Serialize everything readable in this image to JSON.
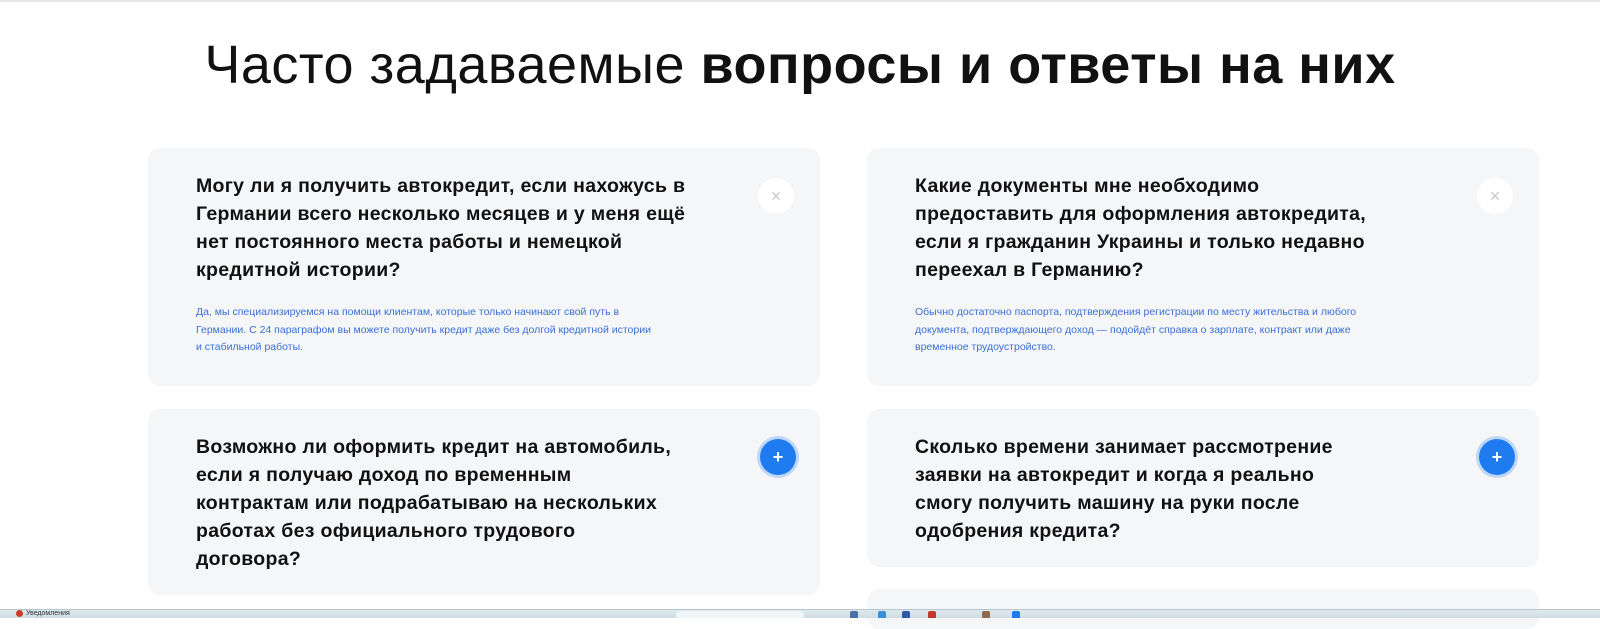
{
  "page": {
    "title_light": "Часто задаваемые",
    "title_bold": "вопросы и ответы на них"
  },
  "faq": {
    "items": [
      {
        "question": "Могу ли я получить автокредит, если нахожусь в Германии всего несколько месяцев и у меня ещё нет постоянного места работы и немецкой кредитной истории?",
        "answer": "Да, мы специализируемся на помощи клиентам, которые только начинают свой путь в Германии. С 24 параграфом вы можете получить кредит даже без долгой кредитной истории и стабильной работы.",
        "expanded": true,
        "toggle_icon": "close-icon",
        "toggle_symbol": "×"
      },
      {
        "question": "Какие документы мне необходимо предоставить для оформления автокредита, если я гражданин Украины и только недавно переехал в Германию?",
        "answer": "Обычно достаточно паспорта, подтверждения регистрации по месту жительства и любого документа, подтверждающего доход — подойдёт справка о зарплате, контракт или даже временное трудоустройство.",
        "expanded": true,
        "toggle_icon": "close-icon",
        "toggle_symbol": "×"
      },
      {
        "question": "Возможно ли оформить кредит на автомобиль, если я получаю доход по временным контрактам или подрабатываю на нескольких работах без официального трудового договора?",
        "answer": "",
        "expanded": false,
        "toggle_icon": "plus-icon",
        "toggle_symbol": "+"
      },
      {
        "question": "Сколько времени занимает рассмотрение заявки на автокредит и когда я реально смогу получить машину на руки после одобрения кредита?",
        "answer": "",
        "expanded": false,
        "toggle_icon": "plus-icon",
        "toggle_symbol": "+"
      }
    ]
  },
  "colors": {
    "accent": "#1e7cf0",
    "answer_text": "#3b6fd6",
    "card_background": "#f5f6f8"
  },
  "taskbar": {
    "app_label": "Уведомления"
  }
}
